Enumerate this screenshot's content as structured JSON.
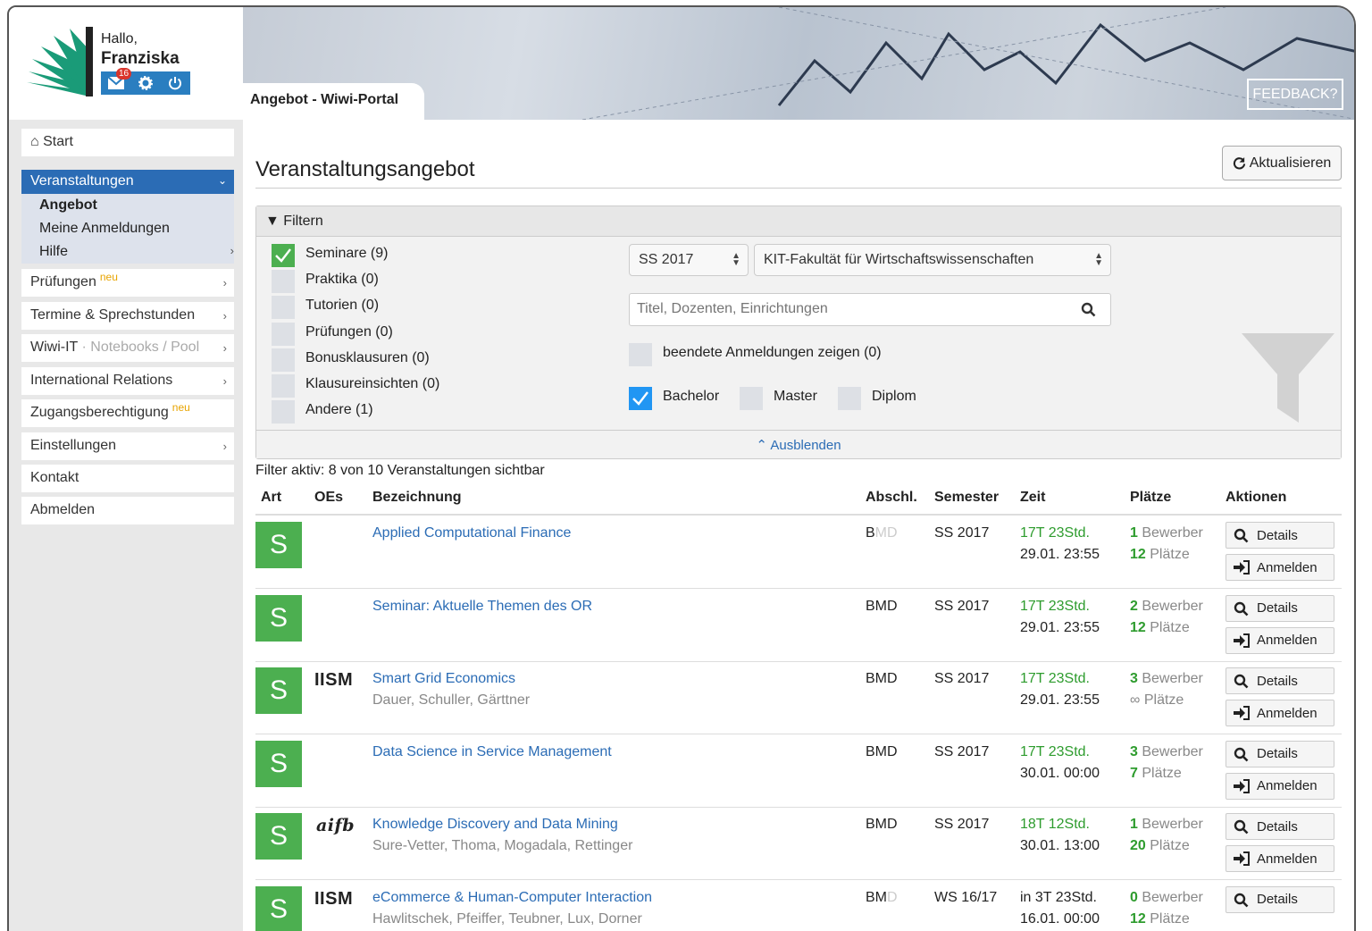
{
  "user": {
    "greeting": "Hallo,",
    "name": "Franziska",
    "mail_count": "16"
  },
  "header": {
    "page_tab": "Angebot - Wiwi-Portal",
    "feedback": "FEEDBACK?"
  },
  "sidebar": {
    "start": "Start",
    "veranstaltungen": "Veranstaltungen",
    "sub": [
      "Angebot",
      "Meine Anmeldungen",
      "Hilfe"
    ],
    "pruefungen": "Prüfungen",
    "neu": "neu",
    "termine": "Termine & Sprechstunden",
    "wiwi_it": "Wiwi-IT",
    "wiwi_it_sep": "·",
    "wiwi_it_sub": "Notebooks / Pool",
    "international": "International Relations",
    "zugang": "Zugangsberechtigung",
    "einstellungen": "Einstellungen",
    "kontakt": "Kontakt",
    "abmelden": "Abmelden"
  },
  "main": {
    "title": "Veranstaltungsangebot",
    "refresh": "Aktualisieren",
    "filter_title": "Filtern",
    "categories": [
      {
        "label": "Seminare (9)",
        "checked": true
      },
      {
        "label": "Praktika (0)",
        "checked": false
      },
      {
        "label": "Tutorien (0)",
        "checked": false
      },
      {
        "label": "Prüfungen (0)",
        "checked": false
      },
      {
        "label": "Bonusklausuren (0)",
        "checked": false
      },
      {
        "label": "Klausureinsichten (0)",
        "checked": false
      },
      {
        "label": "Andere (1)",
        "checked": false
      }
    ],
    "semester_select": "SS 2017",
    "faculty_select": "KIT-Fakultät für Wirtschaftswissenschaften",
    "search_placeholder": "Titel, Dozenten, Einrichtungen",
    "ended_label": "beendete Anmeldungen zeigen (0)",
    "degrees": [
      {
        "label": "Bachelor",
        "checked": true
      },
      {
        "label": "Master",
        "checked": false
      },
      {
        "label": "Diplom",
        "checked": false
      }
    ],
    "hide_label": "Ausblenden",
    "status": "Filter aktiv: 8 von 10 Veranstaltungen sichtbar",
    "columns": [
      "Art",
      "OEs",
      "Bezeichnung",
      "Abschl.",
      "Semester",
      "Zeit",
      "Plätze",
      "Aktionen"
    ],
    "details_label": "Details",
    "register_label": "Anmelden",
    "bewerber_label": "Bewerber",
    "plaetze_label": "Plätze"
  },
  "rows": [
    {
      "art": "S",
      "oe": "",
      "title": "Applied Computational Finance",
      "lecturers": "",
      "absch_strong": "B",
      "absch_dim": "MD",
      "semester": "SS 2017",
      "zeit1": "17T 23Std.",
      "zeit2": "29.01. 23:55",
      "bewerber": "1",
      "plaetze": "12",
      "can_register": true
    },
    {
      "art": "S",
      "oe": "",
      "title": "Seminar: Aktuelle Themen des OR",
      "lecturers": "",
      "absch_strong": "BMD",
      "absch_dim": "",
      "semester": "SS 2017",
      "zeit1": "17T 23Std.",
      "zeit2": "29.01. 23:55",
      "bewerber": "2",
      "plaetze": "12",
      "can_register": true
    },
    {
      "art": "S",
      "oe": "IISM",
      "title": "Smart Grid Economics",
      "lecturers": "Dauer, Schuller, Gärttner",
      "absch_strong": "BMD",
      "absch_dim": "",
      "semester": "SS 2017",
      "zeit1": "17T 23Std.",
      "zeit2": "29.01. 23:55",
      "bewerber": "3",
      "plaetze": "∞",
      "can_register": true
    },
    {
      "art": "S",
      "oe": "",
      "title": "Data Science in Service Management",
      "lecturers": "",
      "absch_strong": "BMD",
      "absch_dim": "",
      "semester": "SS 2017",
      "zeit1": "17T 23Std.",
      "zeit2": "30.01. 00:00",
      "bewerber": "3",
      "plaetze": "7",
      "can_register": true
    },
    {
      "art": "S",
      "oe": "aifb",
      "title": "Knowledge Discovery and Data Mining",
      "lecturers": "Sure-Vetter, Thoma, Mogadala, Rettinger",
      "absch_strong": "BMD",
      "absch_dim": "",
      "semester": "SS 2017",
      "zeit1": "18T 12Std.",
      "zeit2": "30.01. 13:00",
      "bewerber": "1",
      "plaetze": "20",
      "can_register": true
    },
    {
      "art": "S",
      "oe": "IISM",
      "title": "eCommerce & Human-Computer Interaction",
      "lecturers": "Hawlitschek, Pfeiffer, Teubner, Lux, Dorner",
      "absch_strong": "BM",
      "absch_dim": "D",
      "semester": "WS 16/17",
      "zeit1": "in 3T 23Std.",
      "zeit2": "16.01. 00:00",
      "bewerber": "0",
      "plaetze": "12",
      "can_register": false
    }
  ]
}
